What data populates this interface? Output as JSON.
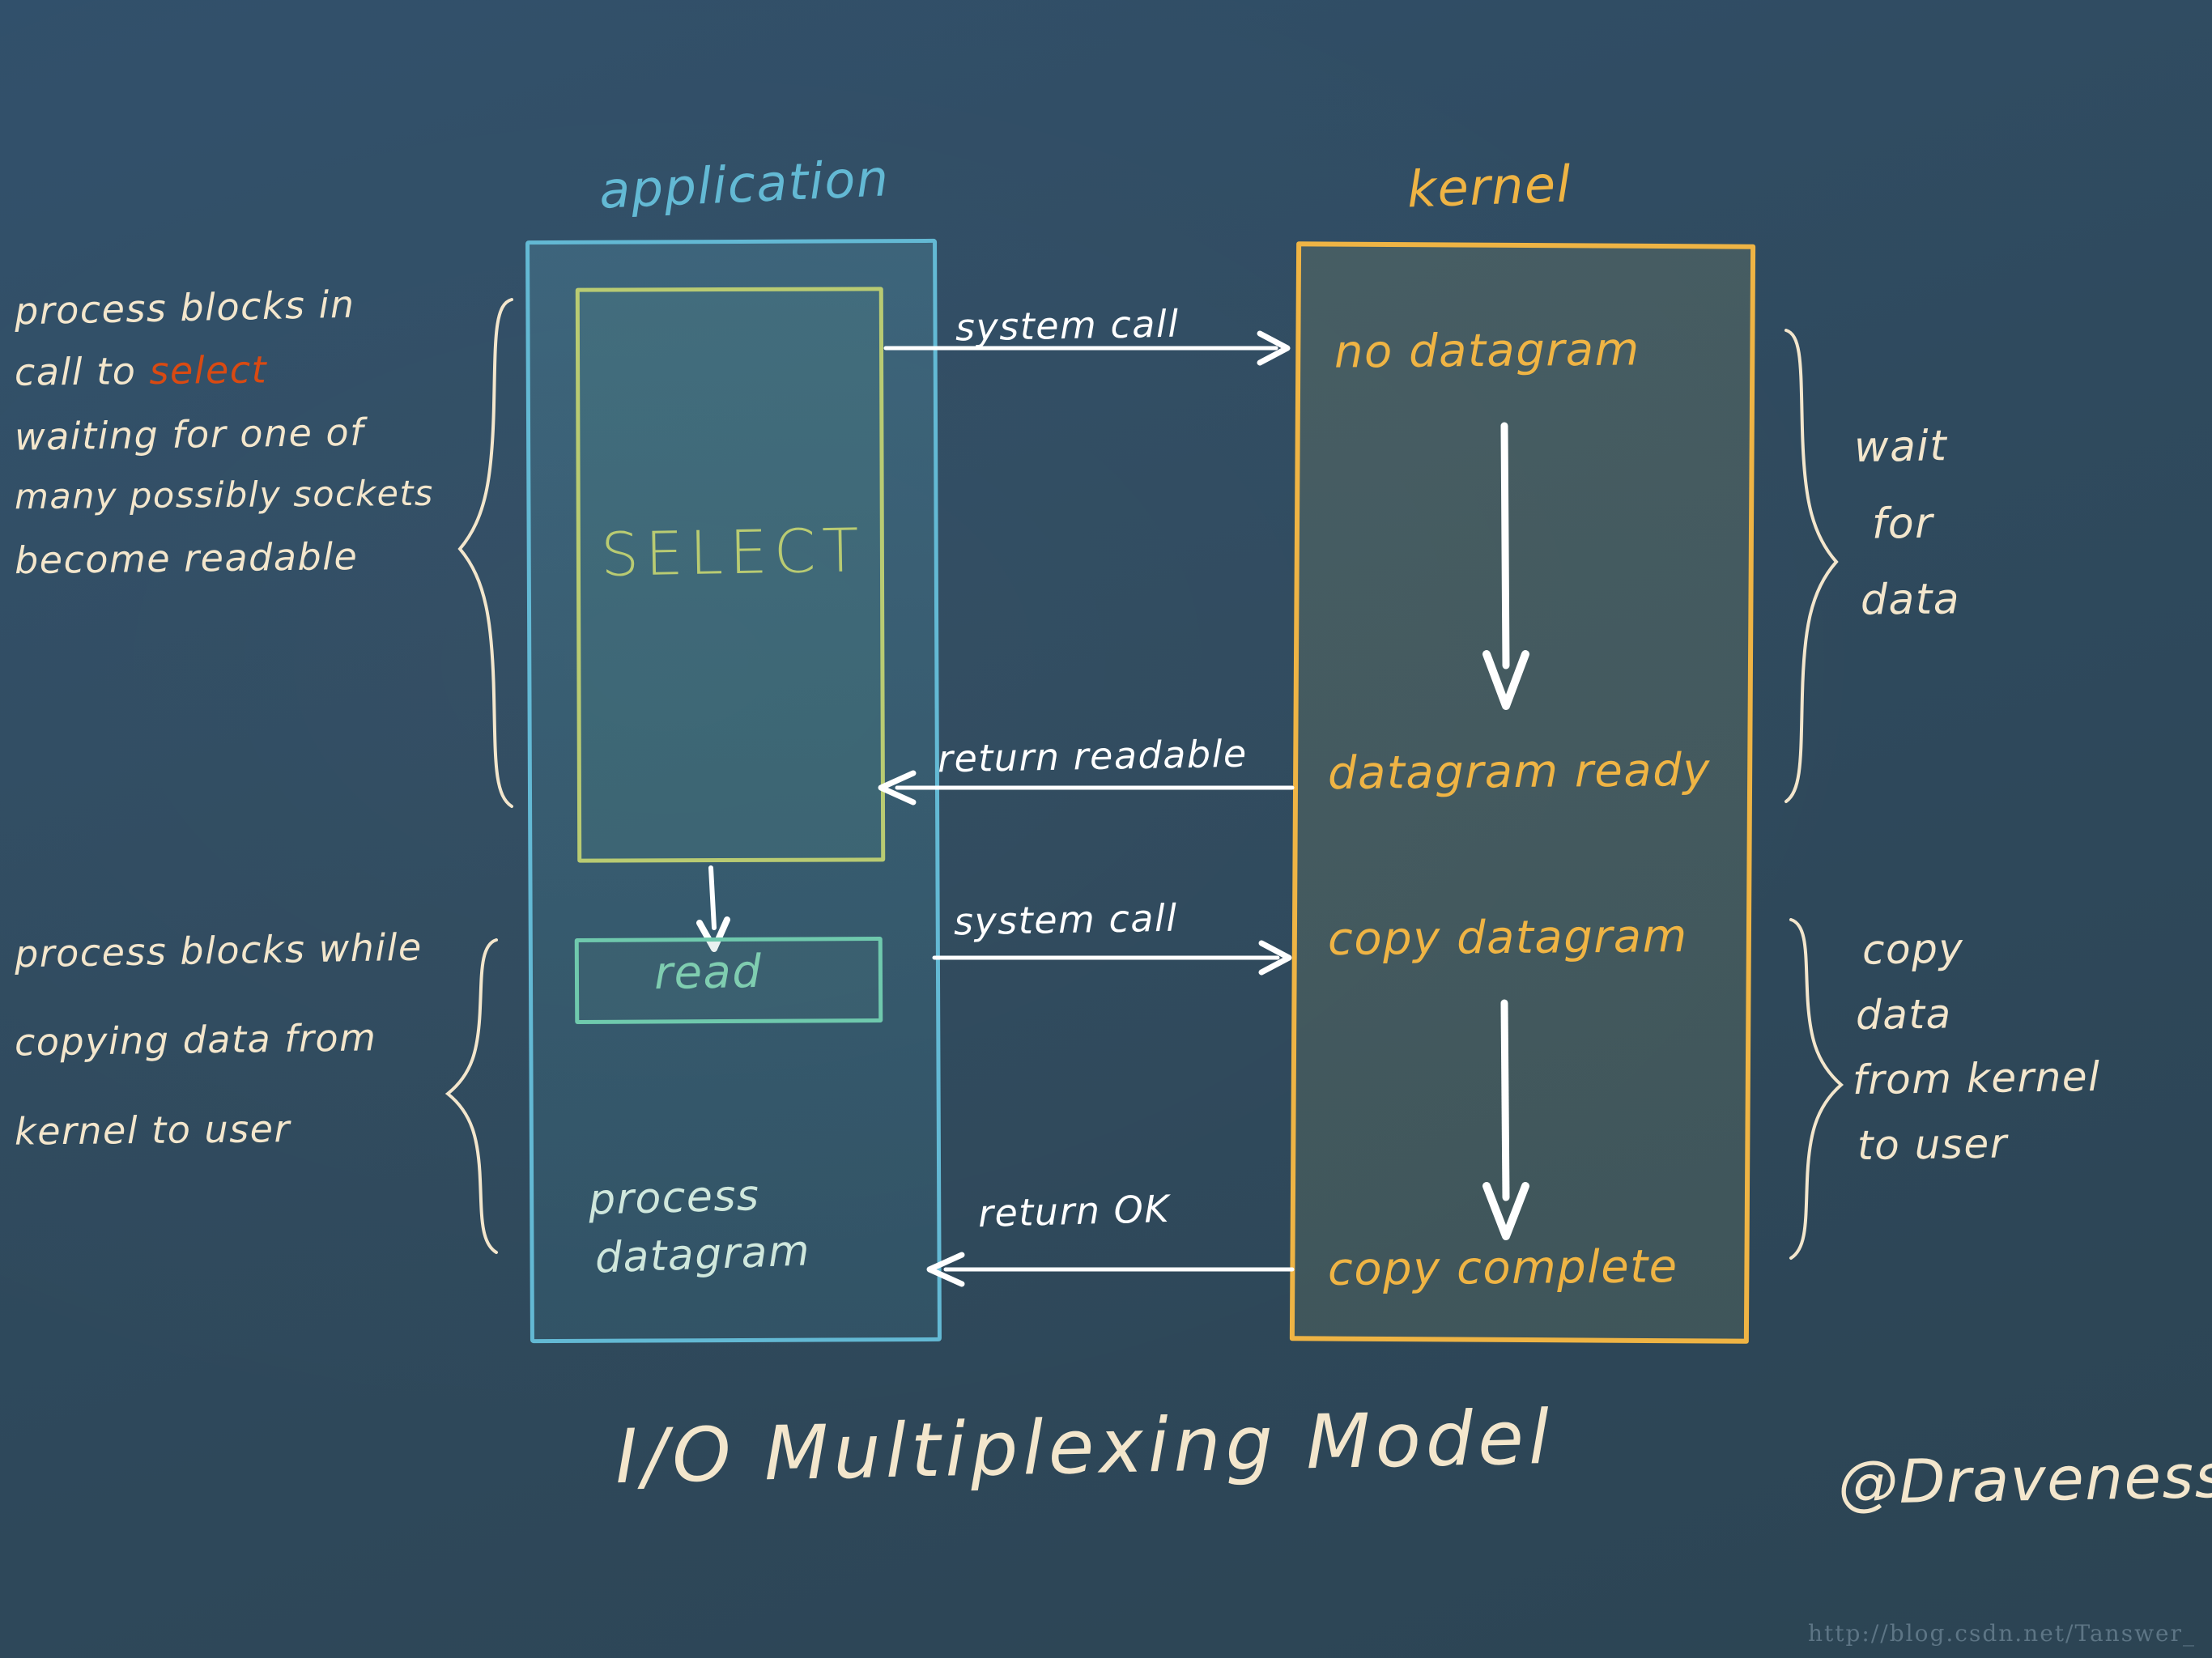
{
  "background_color": "#2e4a5c",
  "palette": {
    "cream": "#f3e6cc",
    "application_blue": "#63b9d4",
    "kernel_amber": "#efb444",
    "select_olive": "#b9cb72",
    "read_mint": "#6fc9ad",
    "process_datagram_mint": "#cfe7dc",
    "arrow_white": "#ffffff",
    "select_keyword_orange": "#d94a12"
  },
  "title": "I/O  Multiplexing  Model",
  "author": "@Draveness",
  "watermark": "http://blog.csdn.net/Tanswer_",
  "columns": {
    "application": {
      "label": "application",
      "inner_block_label": "SELECT",
      "read_block_label": "read",
      "bottom_label_line1": "process",
      "bottom_label_line2": "datagram"
    },
    "kernel": {
      "label": "kernel",
      "steps": [
        "no datagram",
        "datagram ready",
        "copy datagram",
        "copy complete"
      ]
    }
  },
  "arrows": [
    {
      "name": "system-call-select",
      "label": "system call",
      "direction": "right"
    },
    {
      "name": "return-readable",
      "label": "return readable",
      "direction": "left"
    },
    {
      "name": "system-call-read",
      "label": "system call",
      "direction": "right"
    },
    {
      "name": "return-ok",
      "label": "return OK",
      "direction": "left"
    },
    {
      "name": "kernel-wait-flow",
      "label": "",
      "direction": "down"
    },
    {
      "name": "kernel-copy-flow",
      "label": "",
      "direction": "down"
    },
    {
      "name": "select-to-read",
      "label": "",
      "direction": "down"
    }
  ],
  "annotations": {
    "left_top": {
      "lines": [
        "process blocks in",
        "call to ",
        "waiting for one of",
        "many possibly sockets",
        "become  readable"
      ],
      "highlight_word": "select",
      "highlight_line_index": 1
    },
    "left_bottom": {
      "lines": [
        "process blocks while",
        "copying data from",
        "kernel  to  user"
      ]
    },
    "right_top": {
      "lines": [
        "wait",
        "for",
        "data"
      ]
    },
    "right_bottom": {
      "lines": [
        "copy",
        "data",
        "from kernel",
        "to user"
      ]
    }
  }
}
